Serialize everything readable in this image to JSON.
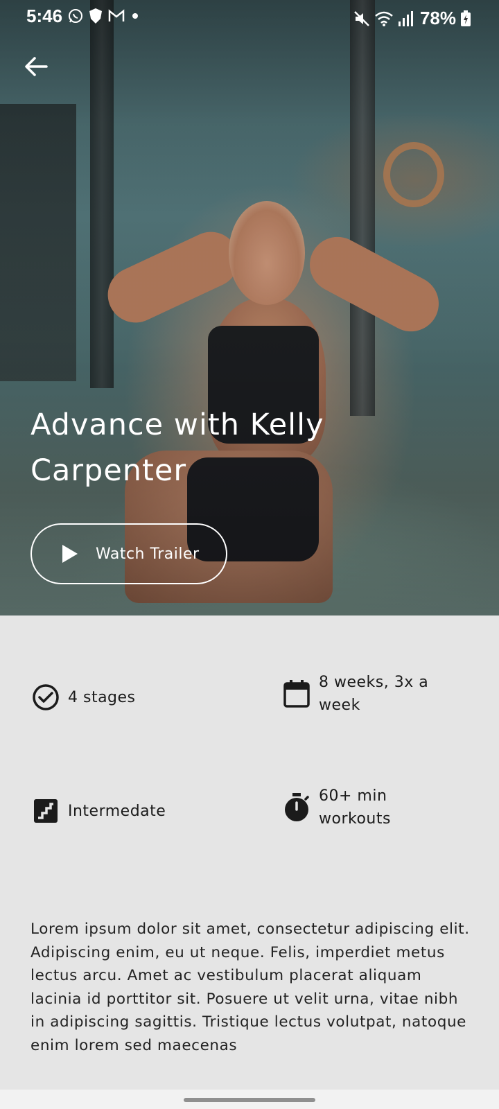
{
  "status_bar": {
    "time": "5:46",
    "battery": "78%",
    "left_icons": [
      "whatsapp-icon",
      "shield-icon",
      "gmail-icon",
      "dot-icon"
    ],
    "right_icons": [
      "mute-icon",
      "wifi-icon",
      "signal-icon",
      "battery-charging-icon"
    ]
  },
  "hero": {
    "title": "Advance with Kelly Carpenter",
    "trailer_label": "Watch Trailer",
    "back_icon": "back-arrow-icon"
  },
  "details": [
    {
      "icon": "check-circle-icon",
      "text": "4 stages"
    },
    {
      "icon": "calendar-icon",
      "text": "8 weeks, 3x a week"
    },
    {
      "icon": "stairs-icon",
      "text": "Intermedate"
    },
    {
      "icon": "stopwatch-icon",
      "text": "60+ min workouts"
    }
  ],
  "description": "Lorem ipsum dolor sit amet, consectetur adipiscing elit. Adipiscing enim, eu ut neque. Felis, imperdiet metus lectus arcu. Amet ac vestibulum placerat aliquam lacinia id porttitor sit. Posuere ut velit urna, vitae nibh in adipiscing sagittis. Tristique lectus volutpat, natoque enim lorem sed maecenas",
  "colors": {
    "background": "#e5e5e5",
    "text": "#1b1b1b",
    "hero_text": "#ffffff"
  }
}
